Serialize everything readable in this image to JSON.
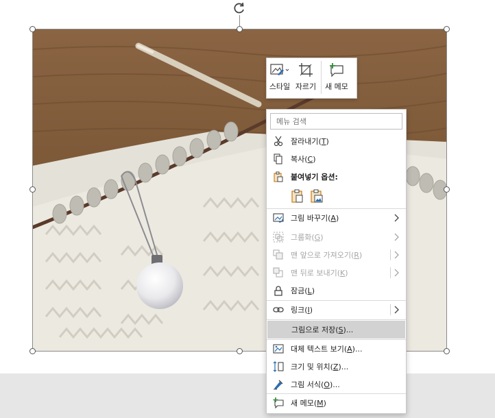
{
  "picture": {
    "alt": "knitting needle with white yarn and a pearl stitch marker"
  },
  "mini_toolbar": {
    "style_label": "스타일",
    "crop_label": "자르기",
    "new_note_label": "새 메모"
  },
  "context_menu": {
    "search_placeholder": "메뉴 검색",
    "cut": {
      "text": "잘라내기",
      "key": "T"
    },
    "copy": {
      "text": "복사",
      "key": "C"
    },
    "paste_options_heading": "붙여넣기 옵션:",
    "change_picture": {
      "text": "그림 바꾸기",
      "key": "A"
    },
    "group": {
      "text": "그룹화",
      "key": "G"
    },
    "bring_to_front": {
      "text": "맨 앞으로 가져오기",
      "key": "R"
    },
    "send_to_back": {
      "text": "맨 뒤로 보내기",
      "key": "K"
    },
    "lock": {
      "text": "잠금",
      "key": "L"
    },
    "link": {
      "text": "링크",
      "key": "I"
    },
    "save_as_picture": {
      "text": "그림으로 저장",
      "key": "S",
      "suffix": "..."
    },
    "alt_text": {
      "text": "대체 텍스트 보기",
      "key": "A",
      "suffix": "..."
    },
    "size_position": {
      "text": "크기 및 위치",
      "key": "Z",
      "suffix": "..."
    },
    "format_picture": {
      "text": "그림 서식",
      "key": "O",
      "suffix": "..."
    },
    "new_note": {
      "text": "새 메모",
      "key": "M"
    }
  },
  "colors": {
    "menu_highlight": "#d2d2d2",
    "disabled_text": "#a6a6a6",
    "icon_blue": "#2b6cb0",
    "icon_orange": "#c77a14"
  }
}
